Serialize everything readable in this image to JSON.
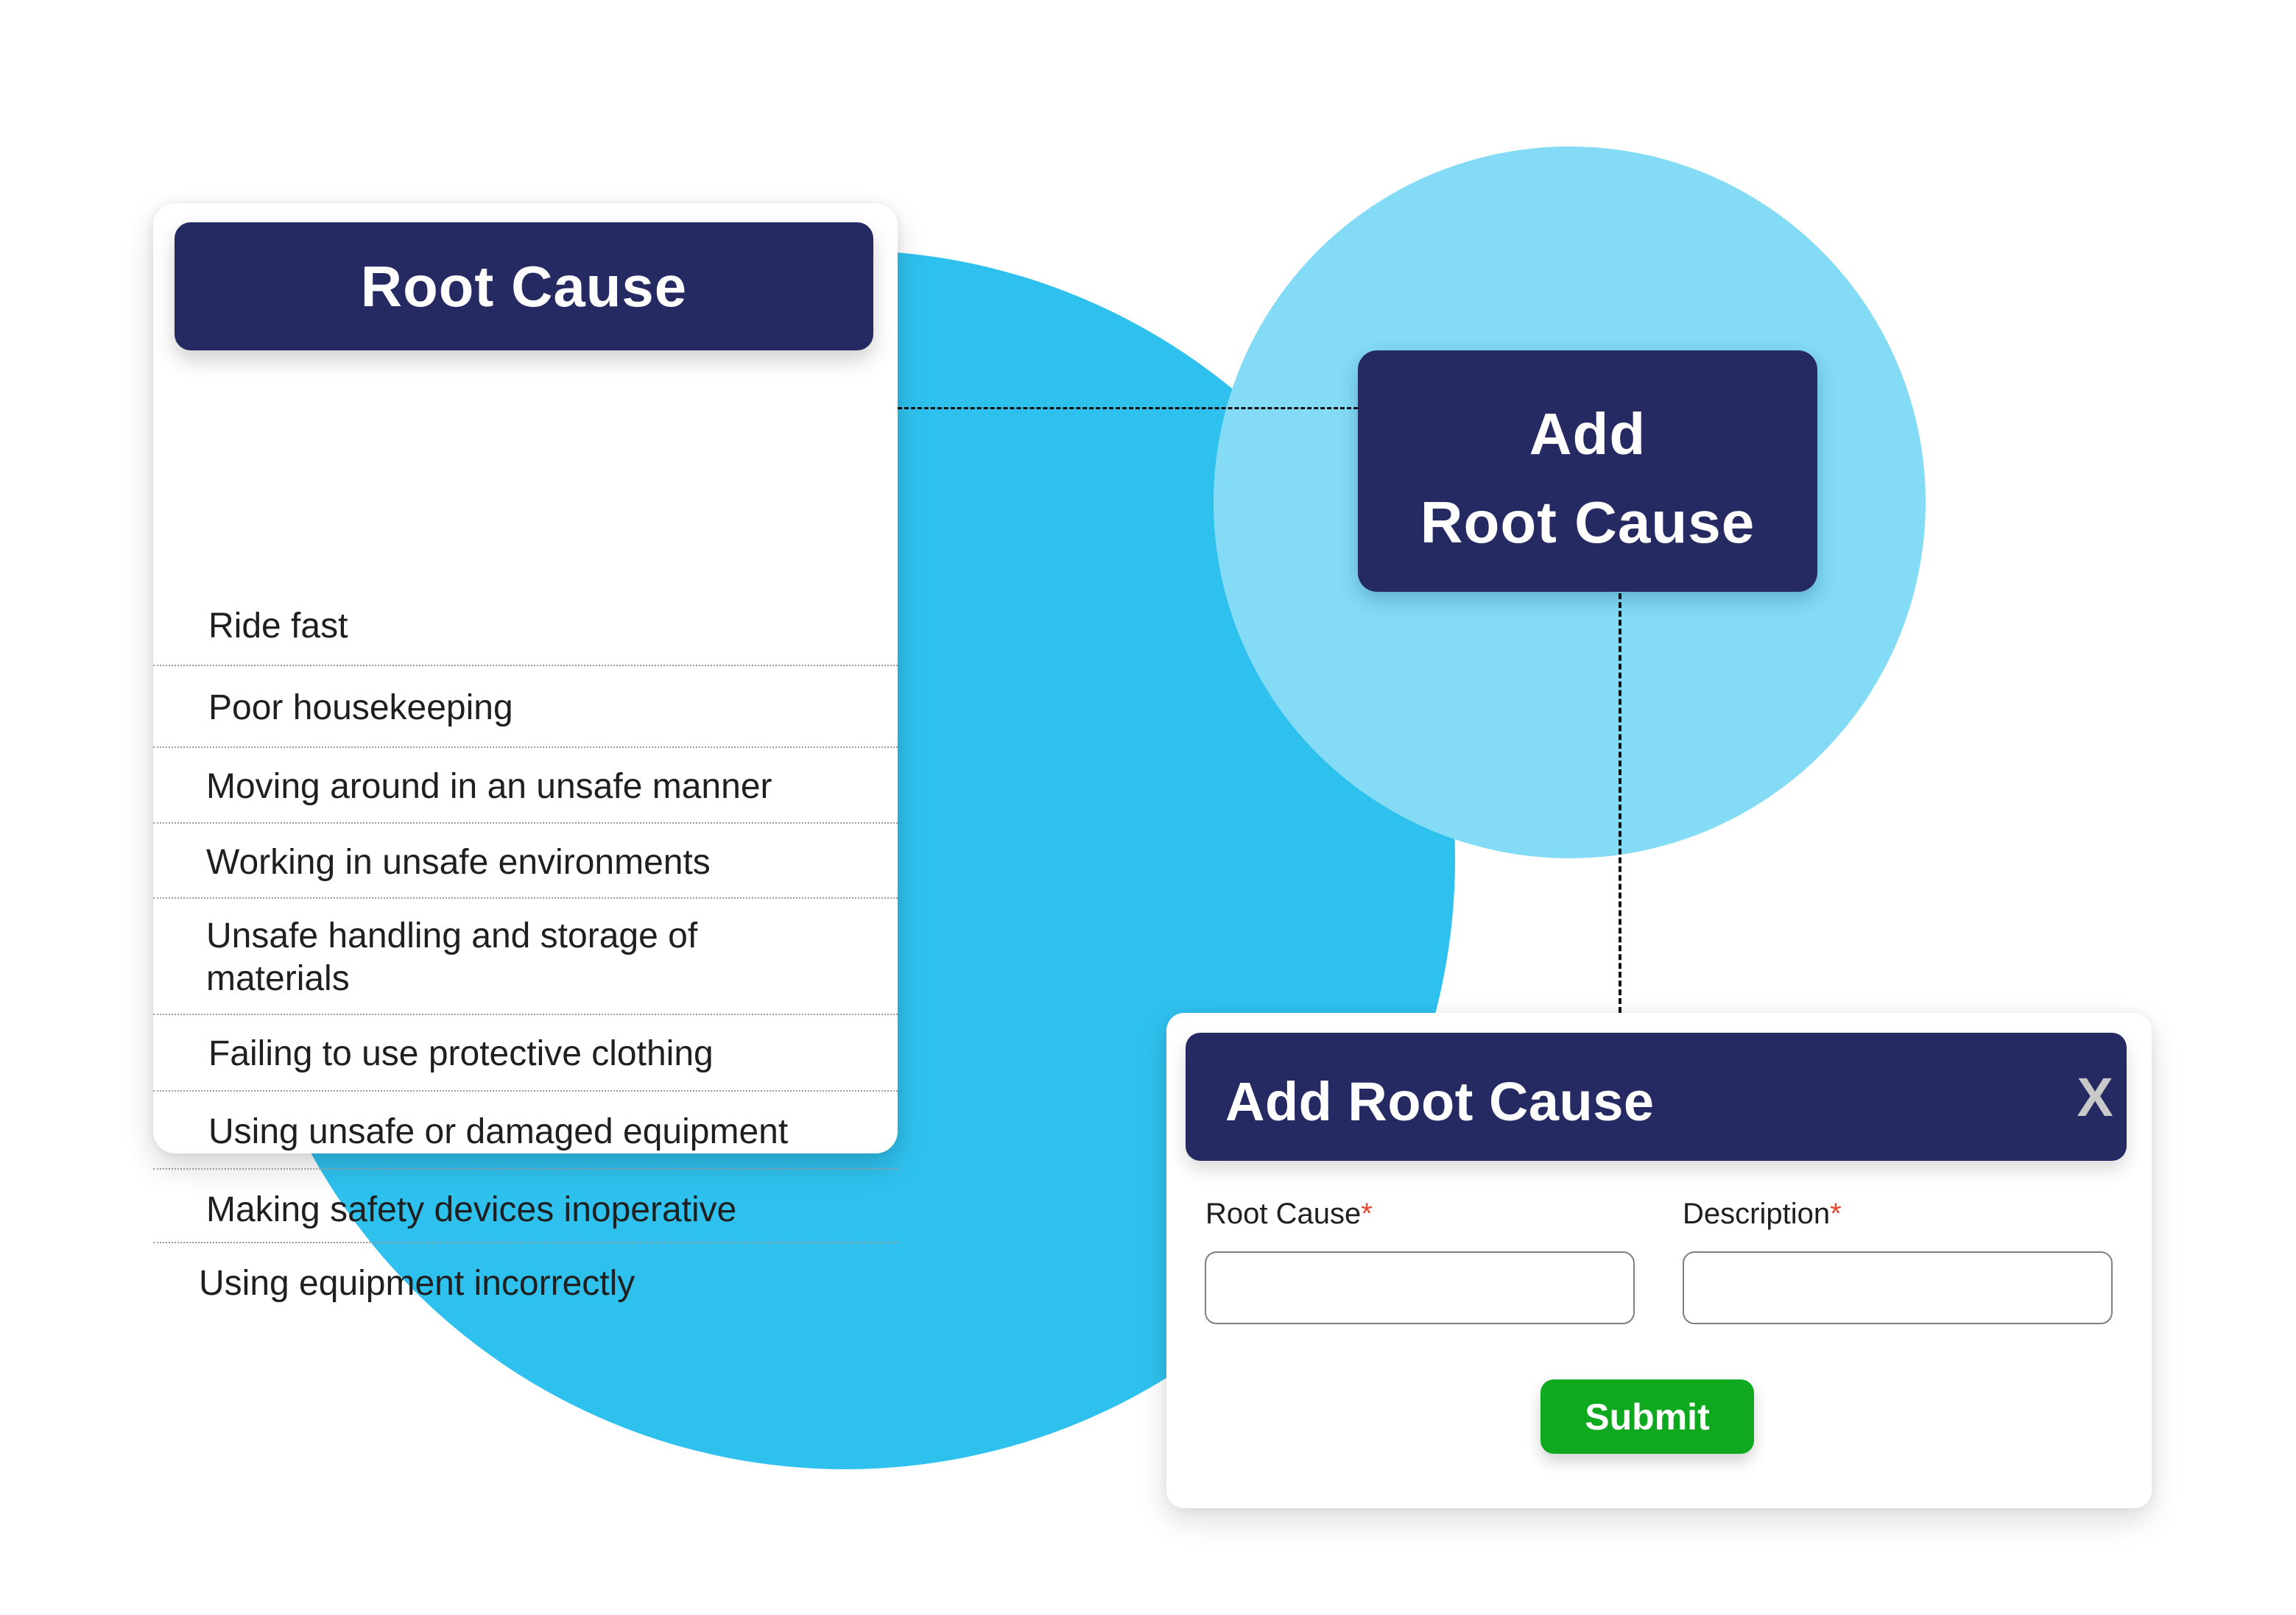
{
  "colors": {
    "navy": "#262a63",
    "big_circle": "#2fc1ee",
    "light_circle": "#84dbf5",
    "submit_green": "#0fa91f",
    "required_asterisk": "#e8472b",
    "close_icon": "#c9c9c9"
  },
  "root_cause_list": {
    "title": "Root Cause",
    "items": [
      "Ride fast",
      "Poor housekeeping",
      "Moving around in an unsafe manner",
      "Working in unsafe environments",
      "Unsafe handling and storage of materials",
      "Failing to use protective clothing",
      "Using unsafe or damaged equipment",
      "Making safety devices inoperative",
      "Using equipment incorrectly"
    ]
  },
  "add_button": {
    "line1": "Add",
    "line2": "Root Cause"
  },
  "dialog": {
    "title": "Add Root Cause",
    "close_label": "X",
    "fields": [
      {
        "label": "Root Cause",
        "required_mark": "*",
        "value": "",
        "placeholder": ""
      },
      {
        "label": "Description",
        "required_mark": "*",
        "value": "",
        "placeholder": ""
      }
    ],
    "submit_label": "Submit"
  }
}
